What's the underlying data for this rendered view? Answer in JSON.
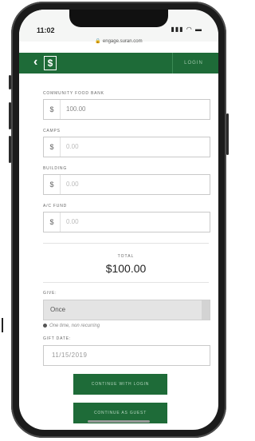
{
  "status": {
    "time": "11:02",
    "icons": "▮▮▮ ◠ ▬"
  },
  "browser": {
    "url": "engage.suran.com"
  },
  "nav": {
    "logo": "$",
    "login": "LOGIN"
  },
  "form": {
    "currency": "$",
    "fields": [
      {
        "label": "COMMUNITY FOOD BANK",
        "value": "100.00"
      },
      {
        "label": "CAMPS",
        "value": "0.00"
      },
      {
        "label": "BUILDING",
        "value": "0.00"
      },
      {
        "label": "A/C FUND",
        "value": "0.00"
      }
    ],
    "total_label": "TOTAL",
    "total_value": "$100.00",
    "give_label": "GIVE:",
    "give_value": "Once",
    "give_hint": "One time, non recurring",
    "gift_date_label": "GIFT DATE:",
    "gift_date_value": "11/15/2019"
  },
  "buttons": {
    "continue_login": "CONTINUE WITH LOGIN",
    "continue_guest": "CONTINUE AS GUEST"
  }
}
